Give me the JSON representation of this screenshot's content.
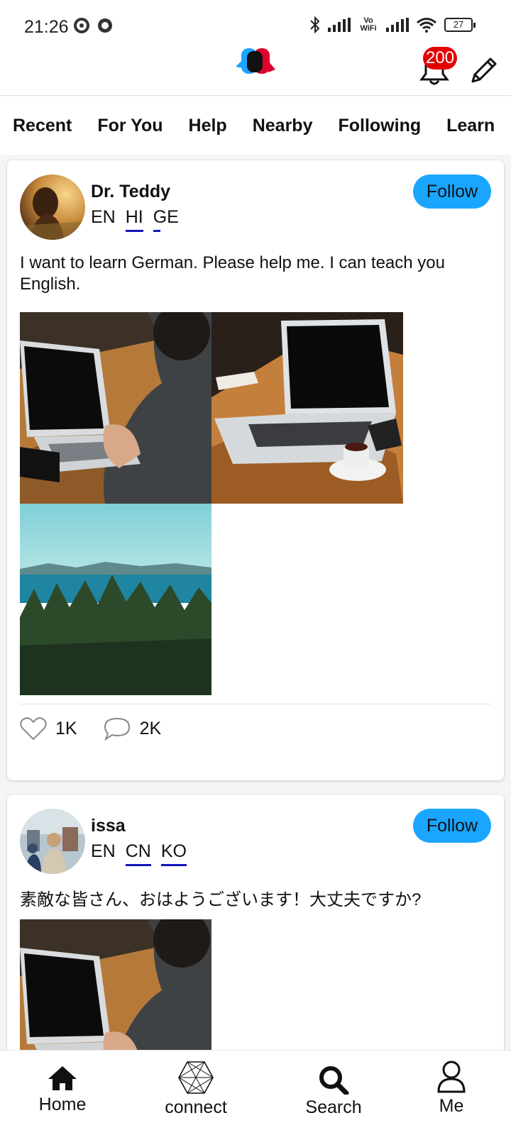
{
  "status_bar": {
    "time": "21:26",
    "network_label": "Vo WiFi",
    "battery": "27"
  },
  "header": {
    "notification_count": "200"
  },
  "tabs": [
    "Recent",
    "For You",
    "Help",
    "Nearby",
    "Following",
    "Learn"
  ],
  "posts": [
    {
      "author": "Dr. Teddy",
      "languages": [
        "EN",
        "HI",
        "GE"
      ],
      "follow_label": "Follow",
      "text": "I want to learn German. Please help me. I can teach you English.",
      "likes": "1K",
      "comments": "2K"
    },
    {
      "author": "issa",
      "languages": [
        "EN",
        "CN",
        "KO"
      ],
      "follow_label": "Follow",
      "text": "素敵な皆さん、おはようございます！大丈夫ですか?"
    }
  ],
  "bottom_nav": [
    "Home",
    "connect",
    "Search",
    "Me"
  ],
  "colors": {
    "accent": "#1aa6ff",
    "badge": "#e40000",
    "underline": "#1414b8"
  }
}
